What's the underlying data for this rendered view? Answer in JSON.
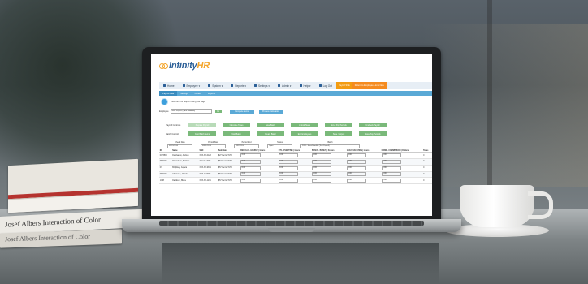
{
  "brand": {
    "prefix": "Infinity",
    "suffix": "HR"
  },
  "nav": [
    {
      "label": "Home",
      "icon": "home-icon"
    },
    {
      "label": "Employee ▾",
      "icon": "user-icon"
    },
    {
      "label": "System ▾",
      "icon": "monitor-icon"
    },
    {
      "label": "Reports ▾",
      "icon": "chart-icon"
    },
    {
      "label": "Settings ▾",
      "icon": "gear-icon"
    },
    {
      "label": "Admin ▾",
      "icon": "wrench-icon"
    },
    {
      "label": "Help ▾",
      "icon": "help-icon"
    },
    {
      "label": "Log Out",
      "icon": "logout-icon"
    }
  ],
  "nav_pills": [
    "Payroll SVE",
    "Return to Employee List & New"
  ],
  "subtabs": [
    "Payroll Data",
    "Settings",
    "Utilities",
    "Reports"
  ],
  "help_text": "Click here for help on using this page",
  "employee": {
    "label": "Employee",
    "value": "New Payroll (Tabs disabled)",
    "go": "Go",
    "btn1": "Complete Items",
    "btn2": "Process Calculation"
  },
  "payroll_controls": {
    "label": "Payroll Controls",
    "buttons": [
      "Prepare Payroll",
      "Calculate Taxes",
      "Save Batch",
      "Unlock Taxes",
      "Move Pay Periods",
      "Uncheck Payroll"
    ]
  },
  "batch_controls": {
    "label": "Batch Controls",
    "buttons": [
      "Cost Batch Items",
      "Void Batch",
      "Create Batch",
      "Edit Employees",
      "Save / Export",
      "Save Pay Periods"
    ]
  },
  "filters": [
    {
      "label": "Check Date",
      "value": "09/15/2016"
    },
    {
      "label": "Period Start",
      "value": "09/01/2016"
    },
    {
      "label": "Period End",
      "value": "09/15/2016"
    },
    {
      "label": "Status",
      "value": "Open"
    },
    {
      "label": "Batch",
      "value": "2016 - Semi-Monthly (Test Payroll)"
    }
  ],
  "columns": [
    "ID",
    "Name",
    "SSN",
    "Sub/Rate",
    "REGULAT- HOURLY | Hours",
    "OT1- OVERTIME | Hours",
    "BONUS- BONUS | Dollars",
    "VAC2- VACATION | Hours",
    "COMM- COMMISSION | Dollars",
    "Taxes"
  ],
  "rows": [
    [
      "0073590",
      "Dumbarton, Andrew",
      "XXX-XX-0123",
      "$27 Per EFT-HR",
      "0.00",
      "0.00",
      "0.00",
      "0.00",
      "0.00",
      "0"
    ],
    [
      "RNT007",
      "Richardson, Barbara",
      "77X-XX-2093",
      "$57 Per EFT-HR",
      "0.00",
      "0.00",
      "0.00",
      "0.00",
      "0.00",
      "0"
    ],
    [
      "07",
      "Brightkey, Angela",
      "XXX-XX-9339",
      "$57 Per EFT-HR",
      "0.00",
      "0.00",
      "0.00",
      "0.00",
      "0.00",
      "0"
    ],
    [
      "RNT008",
      "Chastaine, Charlie",
      "XXX-12-9993",
      "$57 Per EFT-HR",
      "0.00",
      "0.00",
      "0.00",
      "0.00",
      "0.00",
      "0"
    ],
    [
      "1038",
      "Davidson, Blane",
      "XXX-XX-1271",
      "$57 Per EFT-HR",
      "0.00",
      "0.00",
      "0.00",
      "0.00",
      "0.00",
      "0"
    ]
  ],
  "book_spine": "Josef Albers  Interaction of Color",
  "book_spine_2": "Josef Albers  Interaction of Color"
}
